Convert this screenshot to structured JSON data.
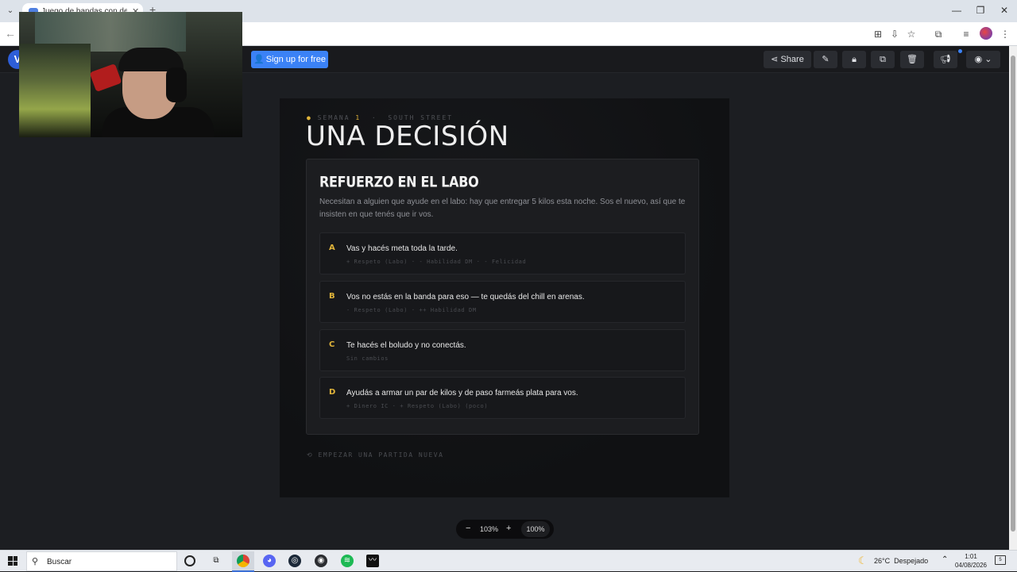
{
  "browser": {
    "tab_title": "Juego de bandas con decision",
    "url_tail": "f"
  },
  "toolbar": {
    "signup_label": "Sign up for free",
    "share_label": "Share"
  },
  "game": {
    "eyebrow_label": "SEMANA",
    "eyebrow_week": "1",
    "eyebrow_sep": "·",
    "eyebrow_location": "SOUTH STREET",
    "hero_title": "UNA DECISIÓN",
    "scenario_title": "REFUERZO EN EL LABO",
    "scenario_desc": "Necesitan a alguien que ayude en el labo: hay que entregar 5 kilos esta noche. Sos el nuevo, así que te insisten en que tenés que ir vos.",
    "options": [
      {
        "letter": "A",
        "text": "Vas y hacés meta toda la tarde.",
        "effects": "+ Respeto (Labo) · - Habilidad DM · - Felicidad"
      },
      {
        "letter": "B",
        "text": "Vos no estás en la banda para eso — te quedás del chill en arenas.",
        "effects": "- Respeto (Labo) · ++ Habilidad DM"
      },
      {
        "letter": "C",
        "text": "Te hacés el boludo y no conectás.",
        "effects": "Sin cambios"
      },
      {
        "letter": "D",
        "text": "Ayudás a armar un par de kilos y de paso farmeás plata para vos.",
        "effects": "+ Dinero IC · + Respeto (Labo) (poco)"
      }
    ],
    "restart_label": "⟲ EMPEZAR UNA PARTIDA NUEVA"
  },
  "zoom": {
    "minus": "−",
    "value": "103%",
    "plus": "+",
    "reset": "100%"
  },
  "taskbar": {
    "search_placeholder": "Buscar",
    "weather_temp": "26°C",
    "weather_desc": "Despejado",
    "time": "1:01",
    "date": "04/08/2026",
    "notif_count": "5"
  },
  "icons": {
    "share": "share-icon",
    "edit": "pencil-icon",
    "lock": "lock-icon",
    "duplicate": "duplicate-icon",
    "delete": "trash-icon",
    "announce": "megaphone-icon",
    "user": "user-icon"
  },
  "colors": {
    "accent_gold": "#e0b43a",
    "signup_blue": "#3b82f6"
  }
}
